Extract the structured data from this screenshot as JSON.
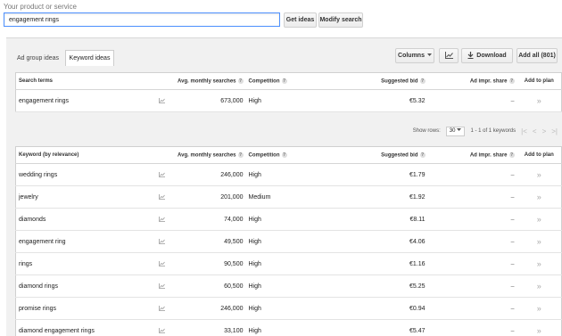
{
  "search": {
    "label": "Your product or service",
    "value": "engagement rings",
    "get_ideas": "Get ideas",
    "modify_search": "Modify search"
  },
  "tabs": [
    "Ad group ideas",
    "Keyword ideas"
  ],
  "toolbar": {
    "columns": "Columns",
    "download": "Download",
    "add_all": "Add all (801)"
  },
  "search_terms": {
    "headers": {
      "term": "Search terms",
      "avg": "Avg. monthly searches",
      "comp": "Competition",
      "bid": "Suggested bid",
      "share": "Ad impr. share",
      "add": "Add to plan"
    },
    "row": {
      "keyword": "engagement rings",
      "avg": "673,000",
      "competition": "High",
      "bid": "€5.32",
      "share": "–"
    }
  },
  "pager": {
    "show_rows": "Show rows:",
    "rows_value": "30",
    "range": "1 - 1 of 1 keywords"
  },
  "keywords": {
    "headers": {
      "term": "Keyword (by relevance)",
      "avg": "Avg. monthly searches",
      "comp": "Competition",
      "bid": "Suggested bid",
      "share": "Ad impr. share",
      "add": "Add to plan"
    },
    "rows": [
      {
        "keyword": "wedding rings",
        "avg": "246,000",
        "competition": "High",
        "bid": "€1.79",
        "share": "–"
      },
      {
        "keyword": "jewelry",
        "avg": "201,000",
        "competition": "Medium",
        "bid": "€1.92",
        "share": "–"
      },
      {
        "keyword": "diamonds",
        "avg": "74,000",
        "competition": "High",
        "bid": "€8.11",
        "share": "–"
      },
      {
        "keyword": "engagement ring",
        "avg": "49,500",
        "competition": "High",
        "bid": "€4.06",
        "share": "–"
      },
      {
        "keyword": "rings",
        "avg": "90,500",
        "competition": "High",
        "bid": "€1.16",
        "share": "–"
      },
      {
        "keyword": "diamond rings",
        "avg": "60,500",
        "competition": "High",
        "bid": "€5.25",
        "share": "–"
      },
      {
        "keyword": "promise rings",
        "avg": "246,000",
        "competition": "High",
        "bid": "€0.94",
        "share": "–"
      },
      {
        "keyword": "diamond engagement rings",
        "avg": "33,100",
        "competition": "High",
        "bid": "€5.47",
        "share": "–"
      }
    ]
  }
}
